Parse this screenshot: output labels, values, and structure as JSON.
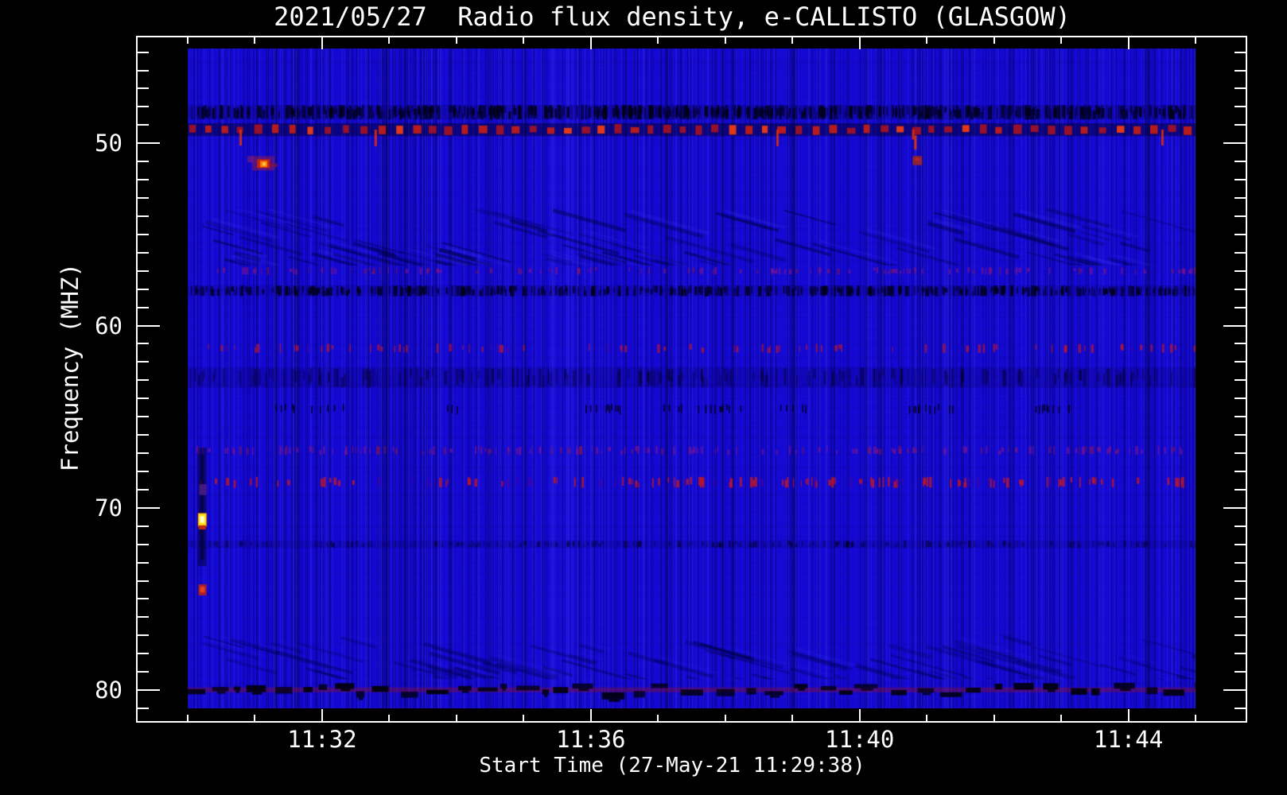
{
  "title": "2021/05/27  Radio flux density, e-CALLISTO (GLASGOW)",
  "station": "GLASGOW",
  "date": "2021/05/27",
  "axes": {
    "x": {
      "label": "Start Time (27-May-21 11:29:38)",
      "start_time": "11:29:38",
      "span_min": 15,
      "major_ticks": [
        {
          "label": "11:32",
          "offset_min": 2
        },
        {
          "label": "11:36",
          "offset_min": 6
        },
        {
          "label": "11:40",
          "offset_min": 10
        },
        {
          "label": "11:44",
          "offset_min": 14
        }
      ],
      "minor_tick_offsets_min": [
        0,
        1,
        3,
        4,
        5,
        7,
        8,
        9,
        11,
        12,
        13,
        15
      ]
    },
    "y": {
      "label": "Frequency (MHZ)",
      "major_ticks": [
        {
          "label": "50",
          "mhz": 50
        },
        {
          "label": "60",
          "mhz": 60
        },
        {
          "label": "70",
          "mhz": 70
        },
        {
          "label": "80",
          "mhz": 80
        }
      ],
      "minor_tick_step_mhz": 1,
      "range_mhz": [
        44.8,
        81.0
      ]
    }
  },
  "chart_data": {
    "type": "heatmap",
    "subtype": "radio-spectrogram",
    "title": "2021/05/27  Radio flux density, e-CALLISTO (GLASGOW)",
    "xlabel": "Start Time (27-May-21 11:29:38)",
    "ylabel": "Frequency (MHZ)",
    "x_range": [
      "11:30:00",
      "11:45:00"
    ],
    "y_range_mhz": [
      44.8,
      81.0
    ],
    "palette": {
      "base": "#1408d2",
      "stripe_dark": "#000019",
      "stripe_bright": "#5a5aff",
      "rfi_red": "#b01422",
      "rfi_bright_red": "#e8421a",
      "burst_core": "#ff7a00",
      "emission_yellow": "#ffe818",
      "emission_white": "#ffffd0",
      "absorption_black": "#00000c",
      "speckle_purple": "#821486"
    },
    "bands": [
      {
        "name": "dark-speckle-band",
        "freq_mhz": [
          47.9,
          48.7
        ],
        "type": "dark-speckle",
        "intensity": 1.0
      },
      {
        "name": "rfi-red-dash-row",
        "freq_mhz": [
          48.9,
          49.6
        ],
        "type": "red-dashes",
        "period_s": 15,
        "drip_offsets_min": [
          0.77,
          2.78,
          8.76,
          10.78,
          14.49
        ]
      },
      {
        "name": "wavy-interference",
        "freq_mhz": [
          53.6,
          56.7
        ],
        "type": "wavy",
        "intensity": 1.0
      },
      {
        "name": "purple-speckle-row",
        "freq_mhz": [
          56.8,
          57.2
        ],
        "type": "purple-speckle",
        "intensity": 0.8
      },
      {
        "name": "dark-speckle-band",
        "freq_mhz": [
          57.8,
          58.4
        ],
        "type": "dark-speckle",
        "intensity": 0.7
      },
      {
        "name": "red-speckle-row",
        "freq_mhz": [
          61.0,
          61.5
        ],
        "type": "red-speckle",
        "intensity": 0.6
      },
      {
        "name": "dark-band",
        "freq_mhz": [
          62.3,
          63.4
        ],
        "type": "dark-row",
        "intensity": 0.5
      },
      {
        "name": "sparse-black-dashes",
        "freq_mhz": [
          64.3,
          64.7
        ],
        "type": "black-sparse",
        "intensity": 1.0
      },
      {
        "name": "purple-speckle-row",
        "freq_mhz": [
          66.6,
          67.1
        ],
        "type": "purple-speckle",
        "intensity": 1.0
      },
      {
        "name": "red-speckle-row",
        "freq_mhz": [
          68.3,
          68.9
        ],
        "type": "red-speckle",
        "intensity": 1.0
      },
      {
        "name": "dark-band",
        "freq_mhz": [
          71.8,
          72.2
        ],
        "type": "dark-row",
        "intensity": 0.4
      },
      {
        "name": "wavy-interference",
        "freq_mhz": [
          77.0,
          79.4
        ],
        "type": "wavy",
        "intensity": 0.6
      },
      {
        "name": "absorption-dash-band",
        "freq_mhz": [
          79.4,
          80.4
        ],
        "type": "black-band",
        "intensity": 1.0
      }
    ],
    "events": [
      {
        "name": "rfi-burst",
        "time": "11:31:05",
        "offset_span_min": [
          0.96,
          1.29
        ],
        "freq_mhz": [
          50.7,
          51.5
        ]
      },
      {
        "name": "rfi-point",
        "time": "11:40:50",
        "offset_span_min": [
          10.79,
          10.93
        ],
        "freq_mhz": [
          50.7,
          51.2
        ]
      },
      {
        "name": "dark-streak",
        "time": "11:30:12",
        "offset_span_min": [
          0.15,
          0.28
        ],
        "freq_mhz": [
          66.7,
          73.2
        ]
      },
      {
        "name": "purple-patch",
        "time": "11:30:12",
        "offset_span_min": [
          0.17,
          0.28
        ],
        "freq_mhz": [
          68.7,
          69.3
        ]
      },
      {
        "name": "bright-emission-point",
        "time": "11:30:12",
        "offset_span_min": [
          0.14,
          0.3
        ],
        "freq_mhz": [
          70.2,
          71.1
        ]
      },
      {
        "name": "red-point",
        "time": "11:30:12",
        "offset_span_min": [
          0.16,
          0.28
        ],
        "freq_mhz": [
          74.2,
          74.8
        ]
      },
      {
        "name": "data-gap-line",
        "time": "11:33:00",
        "offset_span_min": [
          2.95,
          2.98
        ],
        "freq_mhz": [
          44.8,
          81.0
        ]
      }
    ]
  }
}
